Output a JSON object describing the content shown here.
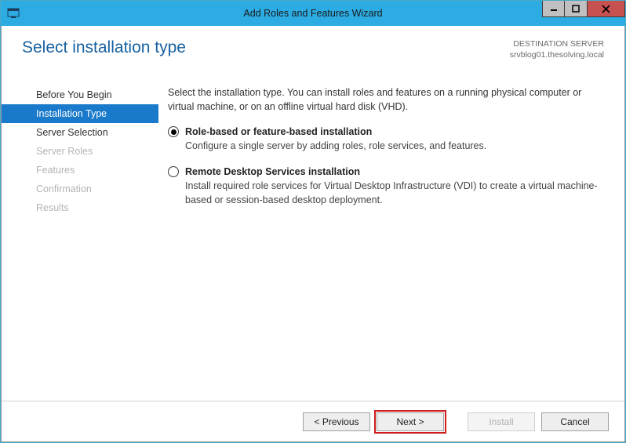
{
  "window": {
    "title": "Add Roles and Features Wizard"
  },
  "header": {
    "page_title": "Select installation type",
    "destination_label": "DESTINATION SERVER",
    "destination_value": "srvblog01.thesolving.local"
  },
  "nav": {
    "items": [
      {
        "label": "Before You Begin",
        "active": false,
        "disabled": false
      },
      {
        "label": "Installation Type",
        "active": true,
        "disabled": false
      },
      {
        "label": "Server Selection",
        "active": false,
        "disabled": false
      },
      {
        "label": "Server Roles",
        "active": false,
        "disabled": true
      },
      {
        "label": "Features",
        "active": false,
        "disabled": true
      },
      {
        "label": "Confirmation",
        "active": false,
        "disabled": true
      },
      {
        "label": "Results",
        "active": false,
        "disabled": true
      }
    ]
  },
  "content": {
    "intro": "Select the installation type. You can install roles and features on a running physical computer or virtual machine, or on an offline virtual hard disk (VHD).",
    "options": [
      {
        "title": "Role-based or feature-based installation",
        "desc": "Configure a single server by adding roles, role services, and features.",
        "checked": true
      },
      {
        "title": "Remote Desktop Services installation",
        "desc": "Install required role services for Virtual Desktop Infrastructure (VDI) to create a virtual machine-based or session-based desktop deployment.",
        "checked": false
      }
    ]
  },
  "footer": {
    "previous": "< Previous",
    "next": "Next >",
    "install": "Install",
    "cancel": "Cancel"
  }
}
